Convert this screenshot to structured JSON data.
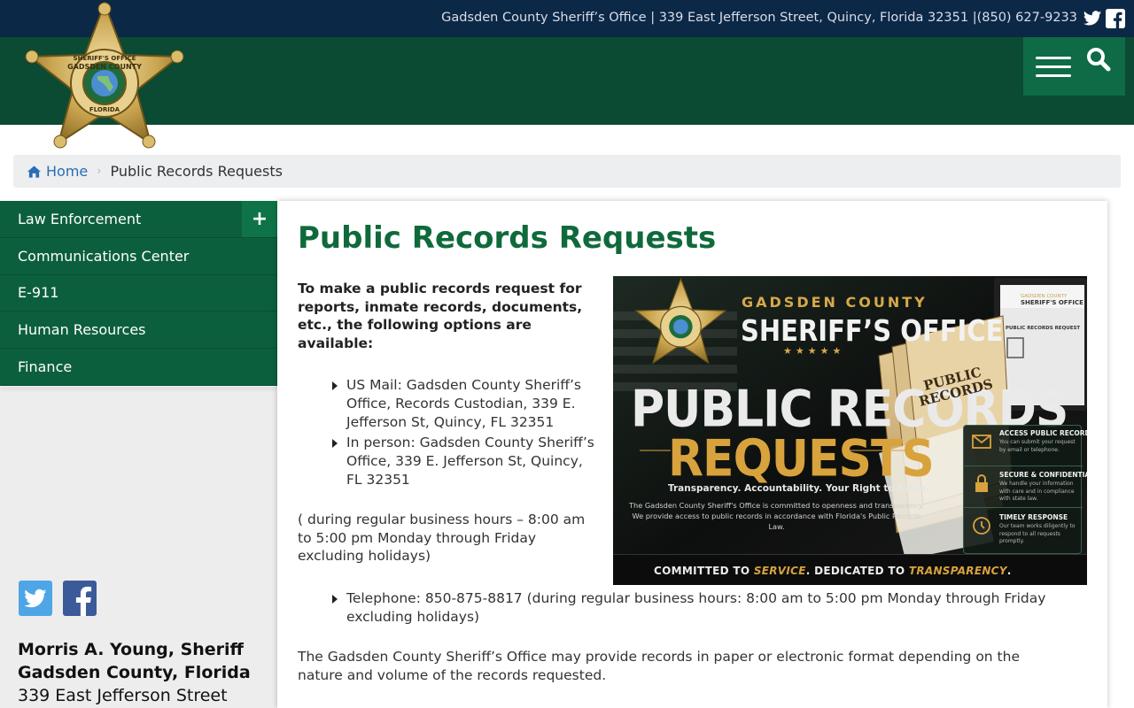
{
  "topbar": {
    "info": "Gadsden County Sheriff’s Office | 339 East Jefferson Street, Quincy, Florida 32351 |(850) 627-9233"
  },
  "badge": {
    "text_top": "SHERIFF'S OFFICE",
    "text_county": "GADSDEN COUNTY",
    "text_bottom": "FLORIDA"
  },
  "breadcrumb": {
    "home": "Home",
    "current": "Public Records Requests"
  },
  "sidebar": {
    "items": [
      {
        "label": "Law Enforcement",
        "expand": "+"
      },
      {
        "label": "Communications Center"
      },
      {
        "label": "E-911"
      },
      {
        "label": "Human Resources"
      },
      {
        "label": "Finance"
      }
    ],
    "contact": {
      "name": "Morris A. Young, Sheriff",
      "county": "Gadsden County, Florida",
      "street": "339 East Jefferson Street"
    }
  },
  "main": {
    "title": "Public Records Requests",
    "intro": "To make a public records request for reports, inmate records, documents, etc., the following options are available:",
    "options": [
      "US Mail: Gadsden County Sheriff’s Office, Records Custodian, 339 E. Jefferson St, Quincy, FL 32351",
      "In person: Gadsden County Sheriff’s Office, 339 E. Jefferson St, Quincy, FL 32351"
    ],
    "hours": "( during regular business hours – 8:00 am to 5:00 pm Monday through Friday excluding holidays)",
    "phone": "Telephone: 850-875-8817 (during regular business hours: 8:00 am to 5:00 pm Monday through Friday excluding holidays)",
    "note": "The Gadsden County Sheriff’s Office may provide records in paper or electronic format depending on the nature and volume of the records requested."
  },
  "banner": {
    "subtitle": "GADSDEN COUNTY",
    "heading": "SHERIFF’S OFFICE",
    "stars": "★★★★★",
    "big1": "PUBLIC RECORDS",
    "big2": "REQUESTS",
    "tagline": "Transparency. Accountability. Your Right to Know.",
    "desc": "The Gadsden County Sheriff's Office is committed to openness and transparency. We provide access to public records in accordance with Florida's Public Records Law.",
    "folder_label": "PUBLIC RECORDS",
    "laptop_brand": "GADSDEN COUNTY",
    "laptop_title": "SHERIFF'S OFFICE",
    "laptop_heading": "PUBLIC RECORDS REQUEST",
    "footer_a": "COMMITTED TO ",
    "footer_b": "SERVICE",
    "footer_c": ". DEDICATED TO ",
    "footer_d": "TRANSPARENCY",
    "footer_e": ".",
    "panel": [
      {
        "title": "ACCESS PUBLIC RECORDS",
        "desc": "You can submit your request by email or telephone.",
        "icon": "envelope-icon"
      },
      {
        "title": "SECURE & CONFIDENTIAL",
        "desc": "We handle your information with care and in compliance with state law.",
        "icon": "lock-icon"
      },
      {
        "title": "TIMELY RESPONSE",
        "desc": "Our team works diligently to respond to all requests promptly.",
        "icon": "clock-icon"
      }
    ]
  },
  "colors": {
    "topbar": "#0c2847",
    "header": "#0b4a33",
    "nav": "#0c5f3d",
    "title": "#0f6a3b",
    "link": "#2a6db5",
    "gold": "#d8a23c"
  }
}
